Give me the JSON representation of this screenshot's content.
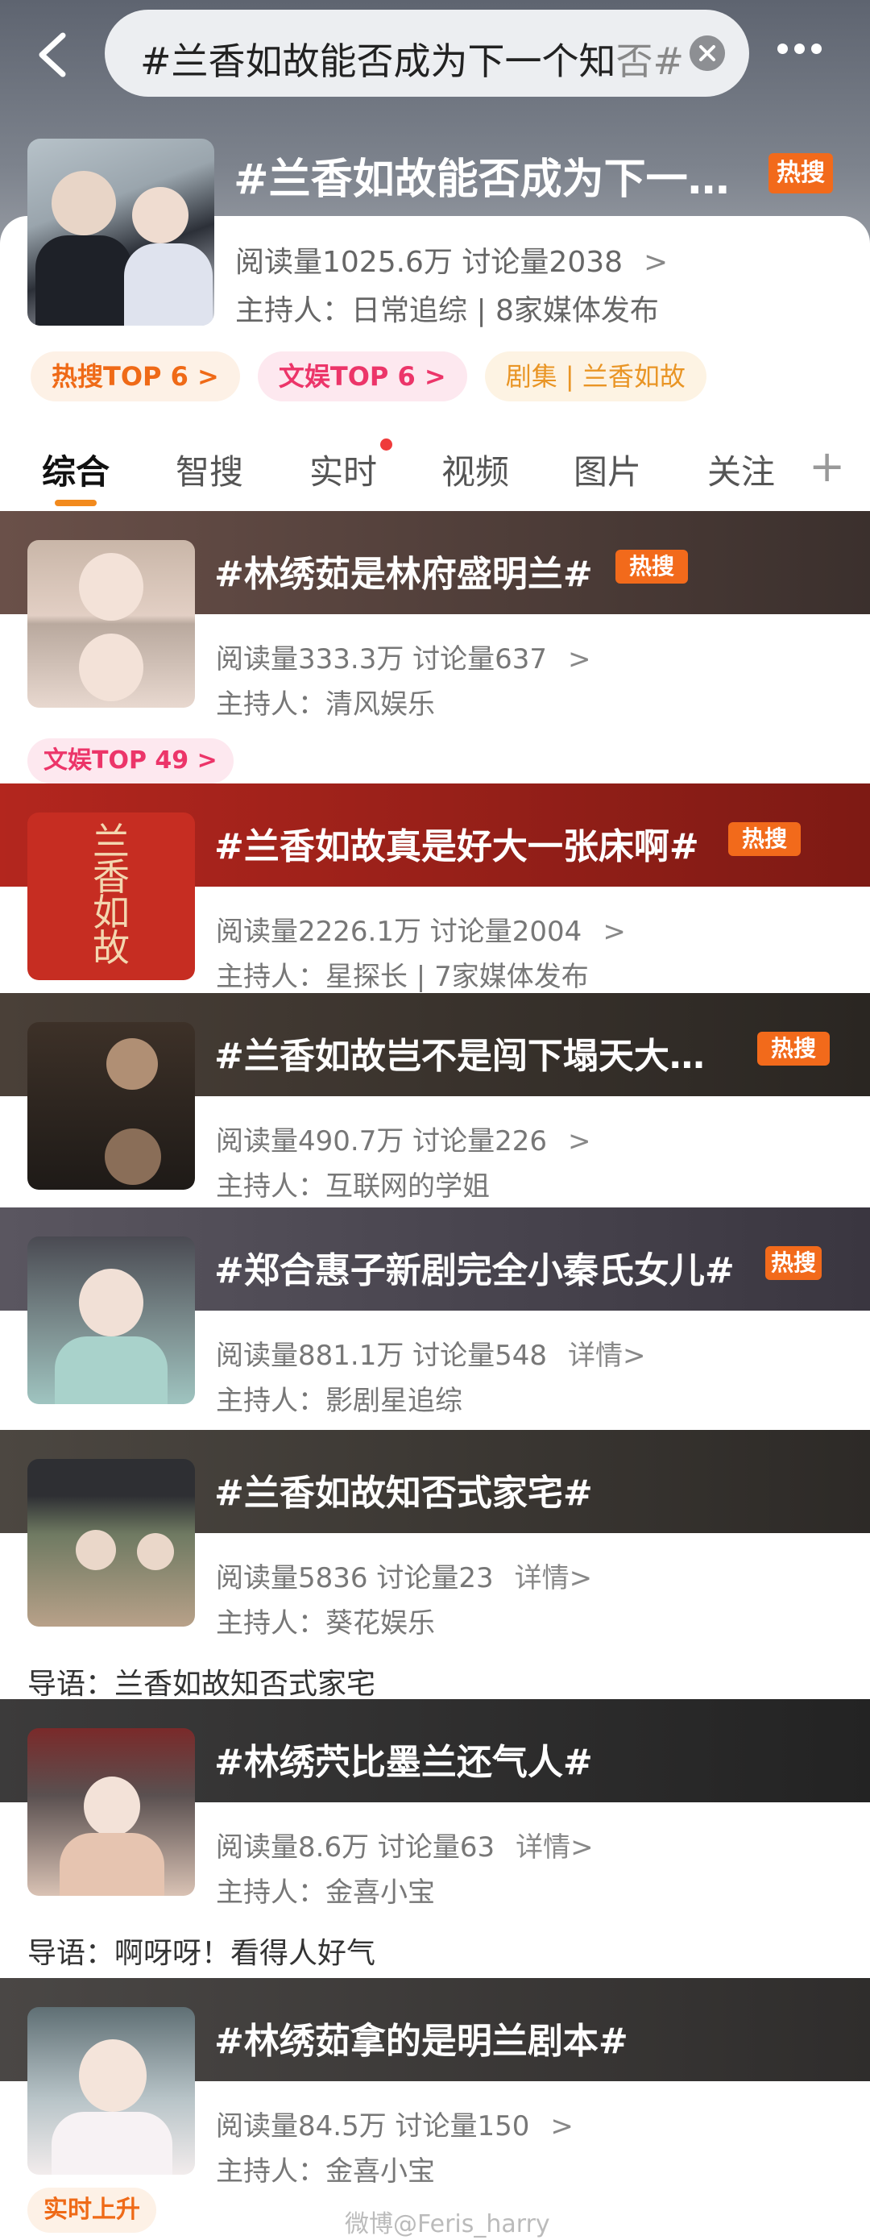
{
  "header": {
    "search_text": "#兰香如故能否成为下一个知否#",
    "search_text_main": "#兰香如故能否成为下一个知",
    "search_text_fade": "否#"
  },
  "topic": {
    "title": "#兰香如故能否成为下一…",
    "hot_label": "热搜",
    "stats": "阅读量1025.6万  讨论量2038",
    "host": "主持人：日常追综 | 8家媒体发布",
    "tags": [
      "热搜TOP 6 >",
      "文娱TOP 6 >",
      "剧集 | 兰香如故"
    ]
  },
  "tabs": [
    "综合",
    "智搜",
    "实时",
    "视频",
    "图片",
    "关注"
  ],
  "results": [
    {
      "title": "#林绣茹是林府盛明兰#",
      "hot": "热搜",
      "stats": "阅读量333.3万  讨论量637",
      "more": ">",
      "host": "主持人：清风娱乐",
      "tag": "文娱TOP 49 >"
    },
    {
      "title": "#兰香如故真是好大一张床啊#",
      "hot": "热搜",
      "stats": "阅读量2226.1万  讨论量2004",
      "more": ">",
      "host": "主持人：星探长 | 7家媒体发布",
      "thumb_text": "兰香如故"
    },
    {
      "title": "#兰香如故岂不是闯下塌天大…",
      "hot": "热搜",
      "stats": "阅读量490.7万  讨论量226",
      "more": ">",
      "host": "主持人：互联网的学姐"
    },
    {
      "title": "#郑合惠子新剧完全小秦氏女儿#",
      "hot": "热搜",
      "stats": "阅读量881.1万  讨论量548",
      "more": "详情>",
      "host": "主持人：影剧星追综"
    },
    {
      "title": "#兰香如故知否式家宅#",
      "stats": "阅读量5836  讨论量23",
      "more": "详情>",
      "host": "主持人：葵花娱乐",
      "intro": "导语：兰香如故知否式家宅"
    },
    {
      "title": "#林绣茓比墨兰还气人#",
      "stats": "阅读量8.6万  讨论量63",
      "more": "详情>",
      "host": "主持人：金喜小宝",
      "intro": "导语：啊呀呀！看得人好气"
    },
    {
      "title": "#林绣茹拿的是明兰剧本#",
      "stats": "阅读量84.5万  讨论量150",
      "more": ">",
      "host": "主持人：金喜小宝",
      "tag": "实时上升"
    }
  ],
  "watermark": "微博@Feris_harry",
  "colors": {
    "accent_orange": "#f26a1b",
    "tab_underline": "#f28a1d",
    "pink": "#ec3569"
  }
}
